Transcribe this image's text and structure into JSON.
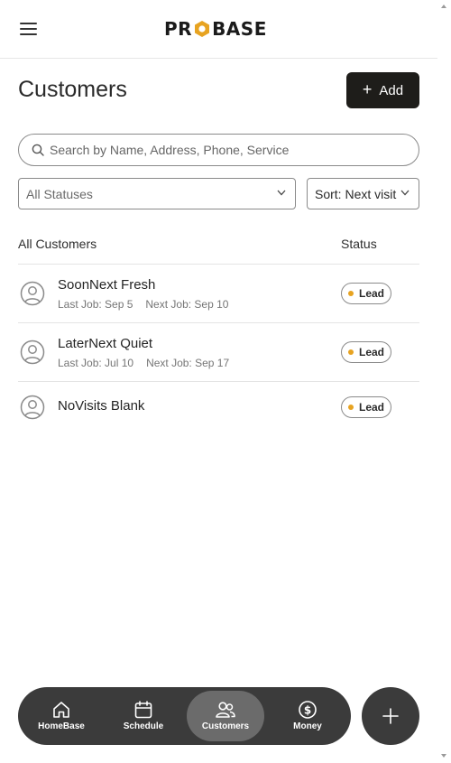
{
  "brand": {
    "logo_left": "PR",
    "logo_right": "BASE",
    "accent": "#e7a321"
  },
  "page": {
    "title": "Customers",
    "add_label": "Add"
  },
  "search": {
    "placeholder": "Search by Name, Address, Phone, Service"
  },
  "filters": {
    "status_selected": "All Statuses",
    "sort_selected": "Sort: Next visit"
  },
  "list": {
    "header_all": "All Customers",
    "header_status": "Status",
    "customers": [
      {
        "name": "SoonNext Fresh",
        "last_job": "Last Job: Sep 5",
        "next_job": "Next Job: Sep 10",
        "status": "Lead"
      },
      {
        "name": "LaterNext Quiet",
        "last_job": "Last Job: Jul 10",
        "next_job": "Next Job: Sep 17",
        "status": "Lead"
      },
      {
        "name": "NoVisits Blank",
        "status": "Lead"
      }
    ]
  },
  "nav": {
    "items": [
      {
        "label": "HomeBase",
        "icon": "home-icon"
      },
      {
        "label": "Schedule",
        "icon": "calendar-icon"
      },
      {
        "label": "Customers",
        "icon": "users-icon",
        "active": true
      },
      {
        "label": "Money",
        "icon": "dollar-icon"
      }
    ]
  },
  "colors": {
    "nav_bg": "#3b3b3b",
    "nav_active": "#6b6b6b",
    "button_dark": "#1e1d1a",
    "lead_dot": "#e7a321"
  }
}
